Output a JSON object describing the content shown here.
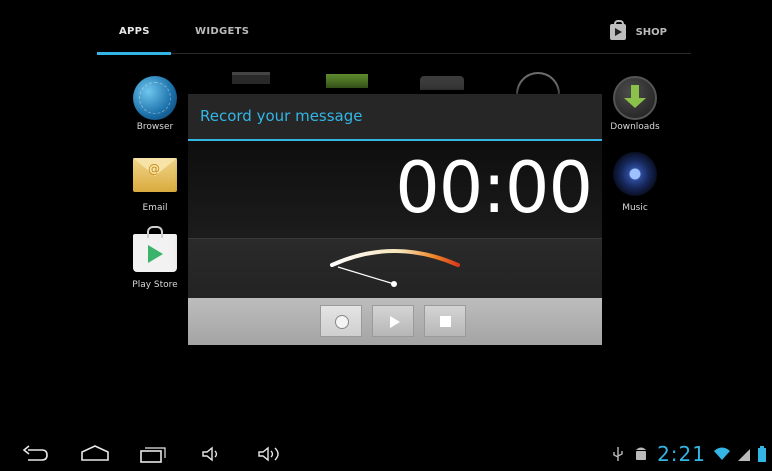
{
  "tabs": {
    "apps": "APPS",
    "widgets": "WIDGETS",
    "shop": "SHOP"
  },
  "apps": {
    "browser": "Browser",
    "email": "Email",
    "play_store": "Play Store",
    "downloads": "Downloads",
    "music": "Music"
  },
  "dialog": {
    "title": "Record your message",
    "timer": "00:00",
    "accent_color": "#33b5e5"
  },
  "status_bar": {
    "time": "2:21"
  },
  "icons": [
    "back-icon",
    "home-icon",
    "recent-apps-icon",
    "volume-down-icon",
    "volume-up-icon",
    "usb-icon",
    "android-debug-icon",
    "wifi-icon",
    "signal-icon",
    "battery-icon"
  ]
}
